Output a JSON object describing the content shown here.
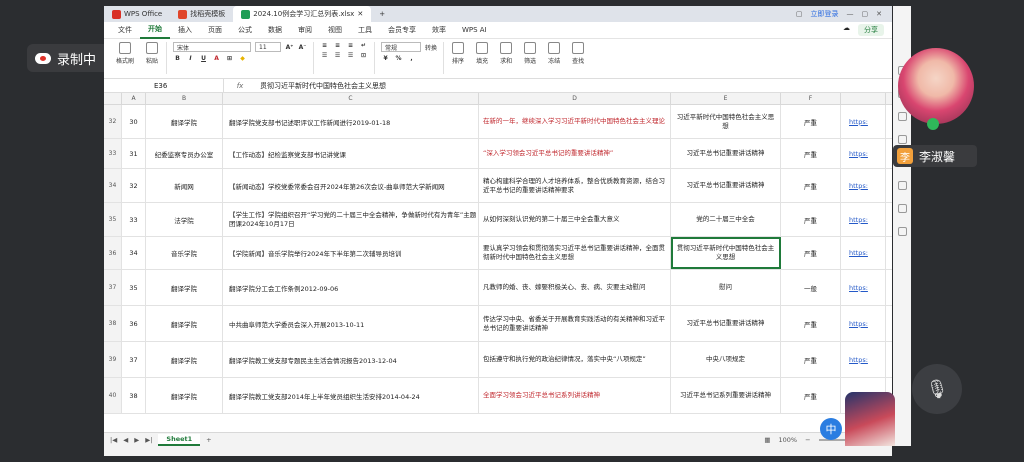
{
  "recorder": {
    "label": "录制中"
  },
  "titlebar": {
    "tabs": [
      {
        "label": "WPS Office",
        "color": "#d93025"
      },
      {
        "label": "找稻壳模板",
        "color": "#e0452a"
      },
      {
        "label": "2024.10例会学习汇总列表.xlsx",
        "color": "#1f9d55"
      }
    ],
    "login_label": "立即登录"
  },
  "menu": {
    "items": [
      "文件",
      "开始",
      "插入",
      "页面",
      "公式",
      "数据",
      "审阅",
      "视图",
      "工具",
      "会员专享",
      "效率",
      "WPS AI"
    ],
    "active": "开始",
    "share_label": "分享"
  },
  "ribbon": {
    "groups": [
      "格式刷",
      "粘贴",
      "转换",
      "排序",
      "填充",
      "求和",
      "筛选",
      "冻结",
      "查找"
    ],
    "font_name": "宋体",
    "font_size": "11",
    "number_format": "常规"
  },
  "formula_bar": {
    "cell_ref": "E36",
    "fx": "fx",
    "content": "贯彻习近平新时代中国特色社会主义思想"
  },
  "columns": [
    "A",
    "B",
    "C",
    "D",
    "E",
    "F"
  ],
  "rows": [
    {
      "rn": "32",
      "a": "30",
      "b": "翻译学院",
      "c": "翻译学院党支部书记述职评议工作新闻进行2019-01-18",
      "d": "在新的一年，继续深入学习习近平新时代中国特色社会主义理论",
      "e": "习近平新时代中国特色社会主义思想",
      "f": "严重",
      "g": "https:"
    },
    {
      "rn": "33",
      "a": "31",
      "b": "纪委监察专员办公室",
      "c": "【工作动态】纪检监察党支部书记讲党课",
      "d": "“深入学习领会习近平总书记的重要讲话精神”",
      "e": "习近平总书记重要讲话精神",
      "f": "严重",
      "g": "https:"
    },
    {
      "rn": "34",
      "a": "32",
      "b": "新闻网",
      "c": "【新闻动态】学校党委常委会召开2024年第26次会议-曲阜师范大学新闻网",
      "d": "精心构建科学合理的人才培养体系，整合优质教育资源，结合习近平总书记的重要讲话精神要求",
      "e": "习近平总书记重要讲话精神",
      "f": "严重",
      "g": "https:"
    },
    {
      "rn": "35",
      "a": "33",
      "b": "法学院",
      "c": "【学生工作】学院组织召开“学习党的二十届三中全会精神，争做新时代有为青年”主题团课2024年10月17日",
      "d": "从如何深刻认识党的第二十届三中全会重大意义",
      "e": "党的二十届三中全会",
      "f": "严重",
      "g": "https:"
    },
    {
      "rn": "36",
      "a": "34",
      "b": "音乐学院",
      "c": "【学院新闻】音乐学院举行2024年下半年第二次辅导员培训",
      "d": "要认真学习领会和贯彻落实习近平总书记重要讲话精神，全面贯彻新时代中国特色社会主义思想",
      "e": "贯彻习近平新时代中国特色社会主义思想",
      "f": "严重",
      "g": "https:"
    },
    {
      "rn": "37",
      "a": "35",
      "b": "翻译学院",
      "c": "翻译学院分工会工作条例2012-09-06",
      "d": "凡教师的婚、丧、嫁娶积极关心、丧、病、灾要主动慰问",
      "e": "慰问",
      "f": "一般",
      "g": "https:"
    },
    {
      "rn": "38",
      "a": "36",
      "b": "翻译学院",
      "c": "中共曲阜师范大学委员会深入开展2013-10-11",
      "d": "传达学习中央、省委关于开展教育实践活动的有关精神和习近平总书记的重要讲话精神",
      "e": "习近平总书记重要讲话精神",
      "f": "严重",
      "g": "https:"
    },
    {
      "rn": "39",
      "a": "37",
      "b": "翻译学院",
      "c": "翻译学院教工党支部专题民主生活会情况报告2013-12-04",
      "d": "包括遵守和执行党的政治纪律情况，落实中央“八项规定”",
      "e": "中央八项规定",
      "f": "严重",
      "g": "https:"
    },
    {
      "rn": "40",
      "a": "38",
      "b": "翻译学院",
      "c": "翻译学院教工党支部2014年上半年党员组织生活安排2014-04-24",
      "d": "全面学习领会习近平总书记系列讲话精神",
      "e": "习近平总书记系列重要讲话精神",
      "f": "严重",
      "g": "https:"
    }
  ],
  "sheetbar": {
    "sheet_name": "Sheet1",
    "zoom": "100%"
  },
  "meeting": {
    "participant_name": "李淑馨",
    "participant_initial": "李",
    "badge": "中"
  }
}
